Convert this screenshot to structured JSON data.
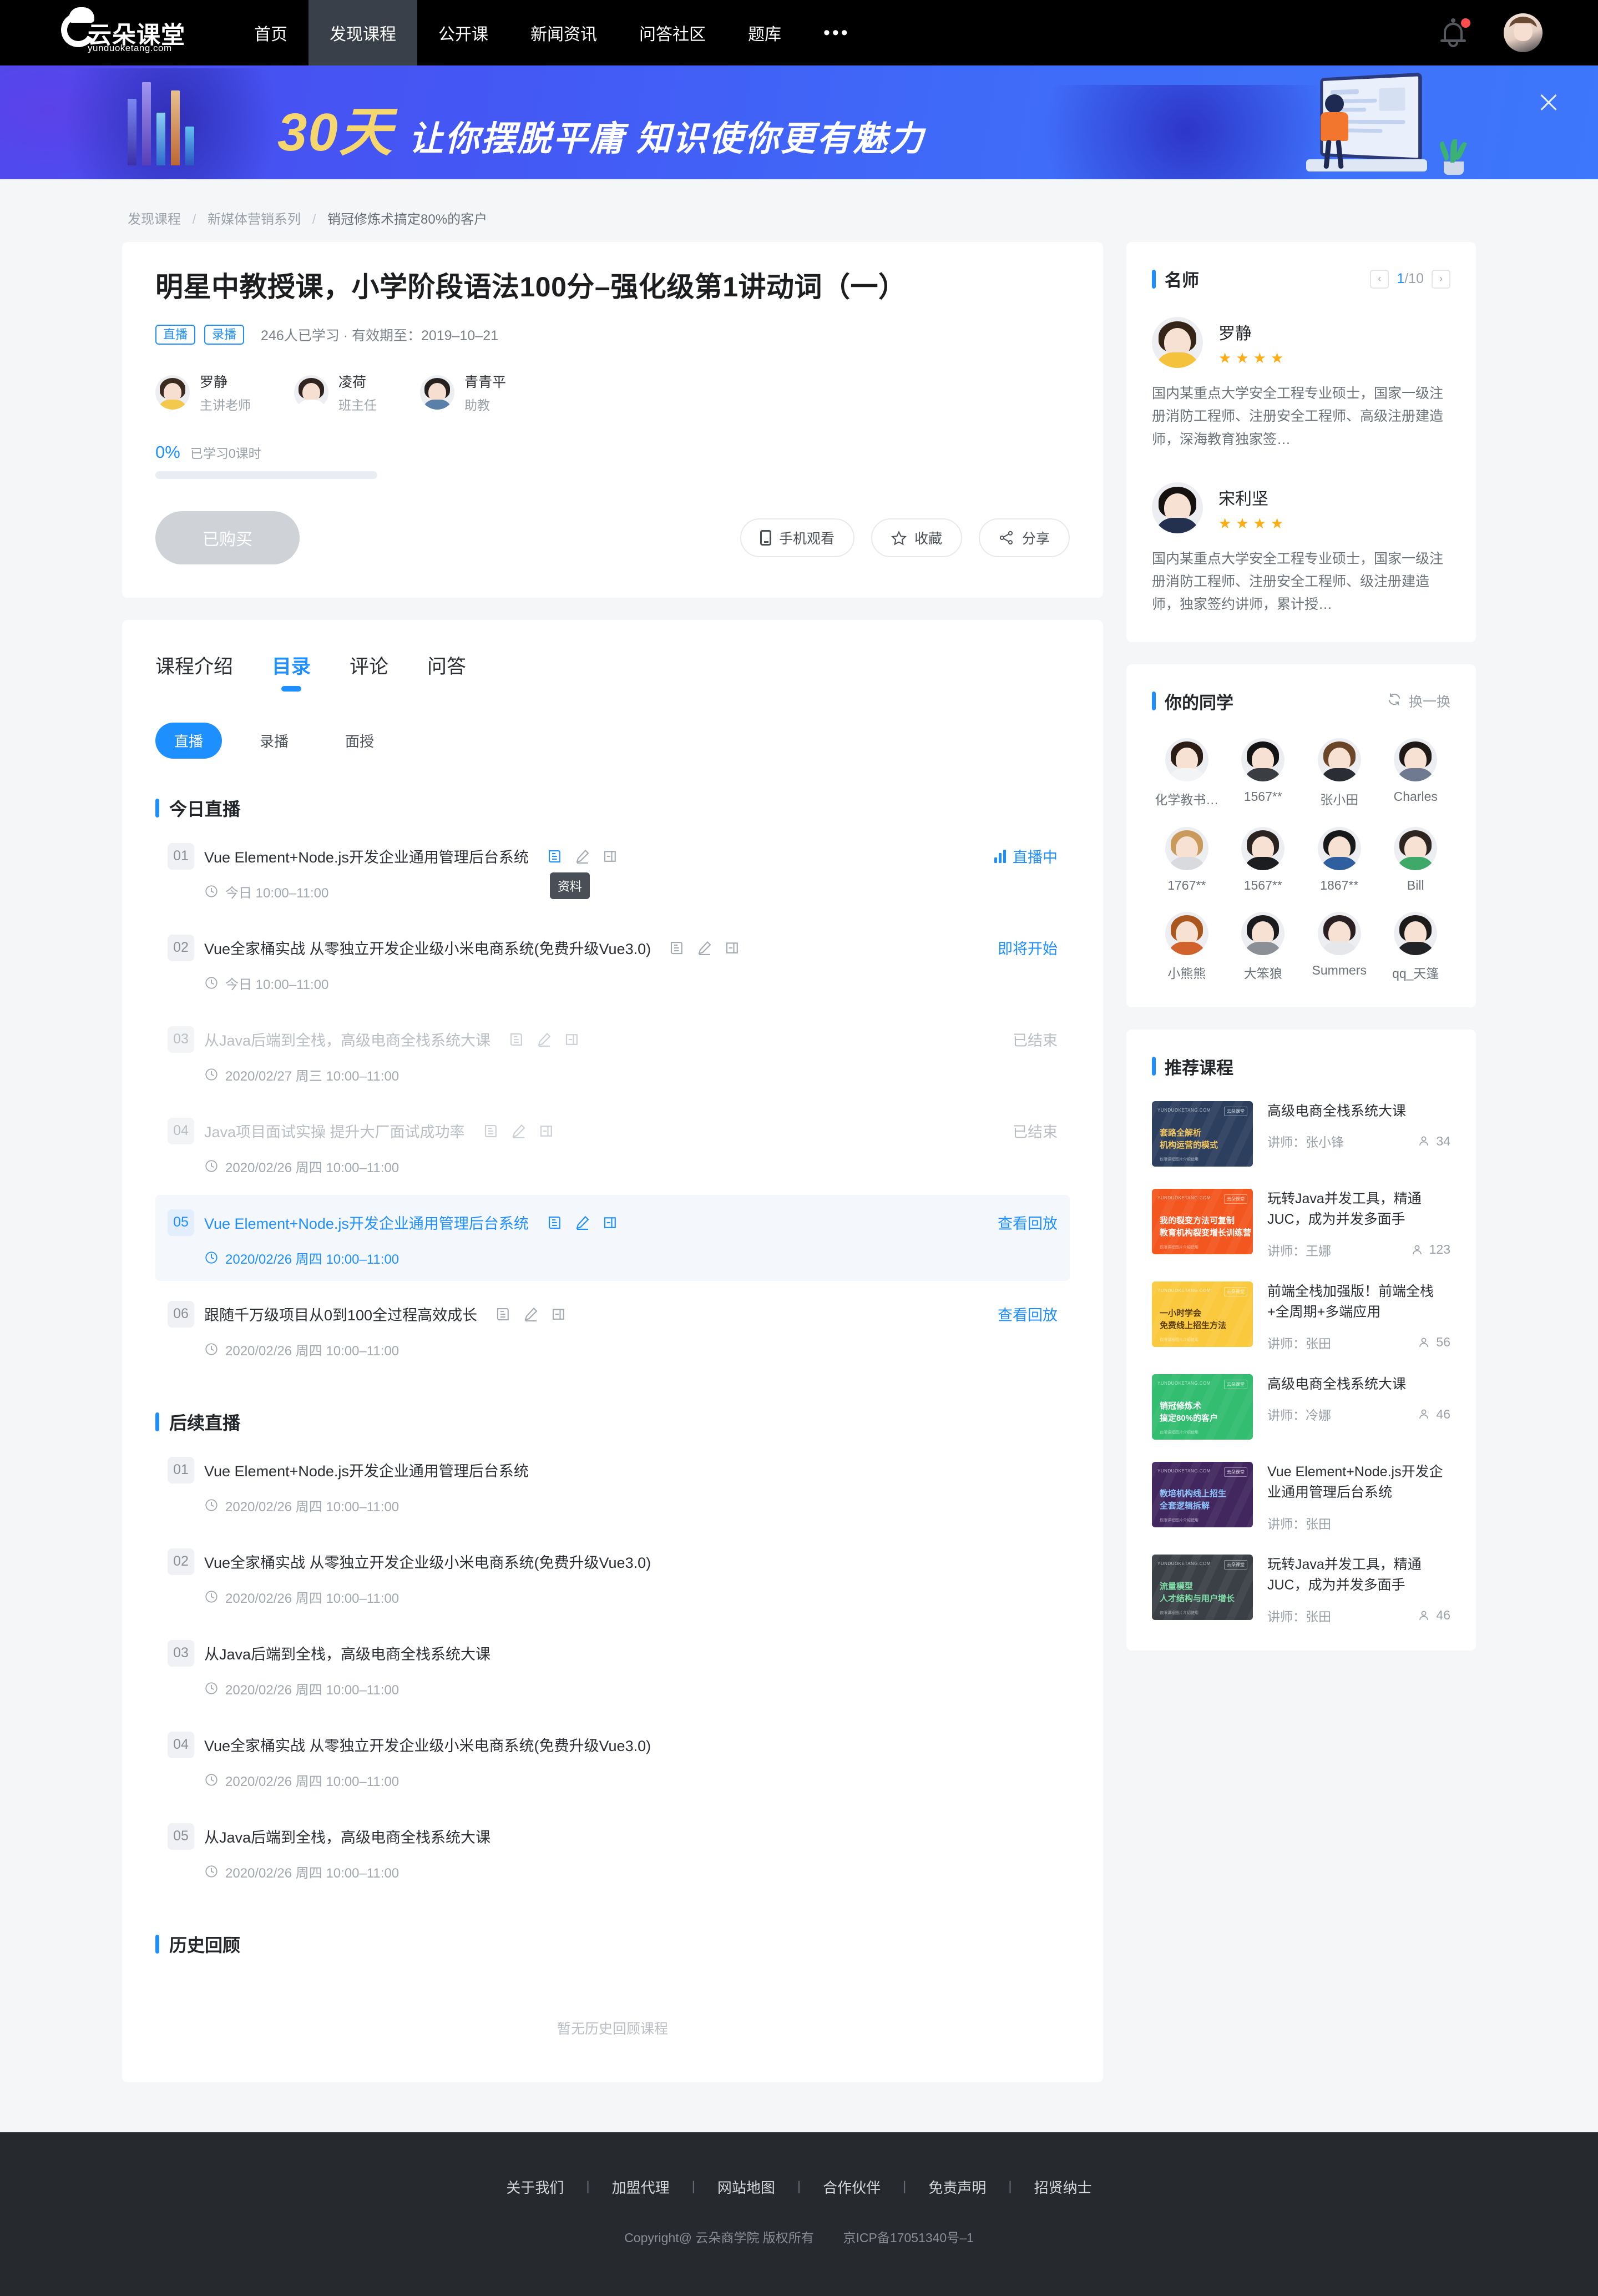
{
  "nav": {
    "logo_cn": "云朵课堂",
    "logo_en": "yunduoketang.com",
    "items": [
      {
        "label": "首页",
        "active": false
      },
      {
        "label": "发现课程",
        "active": true
      },
      {
        "label": "公开课",
        "active": false
      },
      {
        "label": "新闻资讯",
        "active": false
      },
      {
        "label": "问答社区",
        "active": false
      },
      {
        "label": "题库",
        "active": false
      },
      {
        "label": "•••",
        "active": false
      }
    ],
    "bell_icon": "bell-icon",
    "avatar_icon": "user-avatar"
  },
  "banner": {
    "highlight": "30天",
    "text": "让你摆脱平庸  知识使你更有魅力",
    "close_icon": "close-icon"
  },
  "breadcrumb": {
    "items": [
      "发现课程",
      "新媒体营销系列",
      "销冠修炼术搞定80%的客户"
    ],
    "separator": "/"
  },
  "hero": {
    "title": "明星中教授课，小学阶段语法100分–强化级第1讲动词（一）",
    "tags": [
      "直播",
      "录播"
    ],
    "subtitle": "246人已学习 · 有效期至：2019–10–21",
    "teachers": [
      {
        "name": "罗静",
        "role": "主讲老师"
      },
      {
        "name": "凌荷",
        "role": "班主任"
      },
      {
        "name": "青青平",
        "role": "助教"
      }
    ],
    "progress_pct": "0%",
    "progress_value": 0,
    "progress_label": "已学习0课时",
    "buy_button": "已购买",
    "actions": [
      {
        "label": "手机观看",
        "icon": "phone-icon"
      },
      {
        "label": "收藏",
        "icon": "star-icon"
      },
      {
        "label": "分享",
        "icon": "share-icon"
      }
    ]
  },
  "tabs": [
    {
      "label": "课程介绍",
      "active": false
    },
    {
      "label": "目录",
      "active": true
    },
    {
      "label": "评论",
      "active": false
    },
    {
      "label": "问答",
      "active": false
    }
  ],
  "chips": [
    {
      "label": "直播",
      "active": true
    },
    {
      "label": "录播",
      "active": false
    },
    {
      "label": "面授",
      "active": false
    }
  ],
  "sections": [
    {
      "title": "今日直播",
      "lessons": [
        {
          "num": "01",
          "title": "Vue Element+Node.js开发企业通用管理后台系统",
          "time": "今日 10:00–11:00",
          "status": "直播中",
          "state": "live",
          "icons": true,
          "tooltip": "资料"
        },
        {
          "num": "02",
          "title": "Vue全家桶实战 从零独立开发企业级小米电商系统(免费升级Vue3.0)",
          "time": "今日 10:00–11:00",
          "status": "即将开始",
          "state": "upcoming",
          "icons": true
        },
        {
          "num": "03",
          "title": "从Java后端到全栈，高级电商全栈系统大课",
          "time": "2020/02/27 周三 10:00–11:00",
          "status": "已结束",
          "state": "ended",
          "icons": true
        },
        {
          "num": "04",
          "title": "Java项目面试实操 提升大厂面试成功率",
          "time": "2020/02/26 周四 10:00–11:00",
          "status": "已结束",
          "state": "ended",
          "icons": true
        },
        {
          "num": "05",
          "title": "Vue Element+Node.js开发企业通用管理后台系统",
          "time": "2020/02/26 周四 10:00–11:00",
          "status": "查看回放",
          "state": "highlight",
          "icons": true
        },
        {
          "num": "06",
          "title": "跟随千万级项目从0到100全过程高效成长",
          "time": "2020/02/26 周四 10:00–11:00",
          "status": "查看回放",
          "state": "replay",
          "icons": true
        }
      ]
    },
    {
      "title": "后续直播",
      "lessons": [
        {
          "num": "01",
          "title": "Vue Element+Node.js开发企业通用管理后台系统",
          "time": "2020/02/26 周四 10:00–11:00",
          "status": "",
          "state": "plain",
          "icons": false
        },
        {
          "num": "02",
          "title": "Vue全家桶实战 从零独立开发企业级小米电商系统(免费升级Vue3.0)",
          "time": "2020/02/26 周四 10:00–11:00",
          "status": "",
          "state": "plain",
          "icons": false
        },
        {
          "num": "03",
          "title": "从Java后端到全栈，高级电商全栈系统大课",
          "time": "2020/02/26 周四 10:00–11:00",
          "status": "",
          "state": "plain",
          "icons": false
        },
        {
          "num": "04",
          "title": "Vue全家桶实战 从零独立开发企业级小米电商系统(免费升级Vue3.0)",
          "time": "2020/02/26 周四 10:00–11:00",
          "status": "",
          "state": "plain",
          "icons": false
        },
        {
          "num": "05",
          "title": "从Java后端到全栈，高级电商全栈系统大课",
          "time": "2020/02/26 周四 10:00–11:00",
          "status": "",
          "state": "plain",
          "icons": false
        }
      ]
    },
    {
      "title": "历史回顾",
      "lessons": [],
      "empty": "暂无历史回顾课程"
    }
  ],
  "side_teachers": {
    "title": "名师",
    "page_current": "1",
    "page_total": "/10",
    "prev_icon": "chevron-left-icon",
    "next_icon": "chevron-right-icon",
    "list": [
      {
        "name": "罗静",
        "stars": 4,
        "desc": "国内某重点大学安全工程专业硕士，国家一级注册消防工程师、注册安全工程师、高级注册建造师，深海教育独家签…"
      },
      {
        "name": "宋利坚",
        "stars": 4,
        "desc": "国内某重点大学安全工程专业硕士，国家一级注册消防工程师、注册安全工程师、级注册建造师，独家签约讲师，累计授…"
      }
    ]
  },
  "side_mates": {
    "title": "你的同学",
    "refresh_label": "换一换",
    "refresh_icon": "refresh-icon",
    "list": [
      {
        "name": "化学教书…"
      },
      {
        "name": "1567**"
      },
      {
        "name": "张小田"
      },
      {
        "name": "Charles"
      },
      {
        "name": "1767**"
      },
      {
        "name": "1567**"
      },
      {
        "name": "1867**"
      },
      {
        "name": "Bill"
      },
      {
        "name": "小熊熊"
      },
      {
        "name": "大笨狼"
      },
      {
        "name": "Summers"
      },
      {
        "name": "qq_天篷"
      }
    ]
  },
  "side_recommend": {
    "title": "推荐课程",
    "teacher_prefix": "讲师：",
    "list": [
      {
        "title": "高级电商全栈系统大课",
        "teacher": "张小锋",
        "count": "34",
        "thumb_color": "#2c3f5e",
        "thumb_l1": "套路全解析",
        "thumb_l2": "机构运营的模式",
        "thumb_title_color": "#f5c862"
      },
      {
        "title": "玩转Java并发工具，精通JUC，成为并发多面手",
        "teacher": "王娜",
        "count": "123",
        "thumb_color": "#f4561f",
        "thumb_l1": "我的裂变方法可复制",
        "thumb_l2": "教育机构裂变增长训练营",
        "thumb_title_color": "#ffffff"
      },
      {
        "title": "前端全栈加强版！前端全栈+全周期+多端应用",
        "teacher": "张田",
        "count": "56",
        "thumb_color": "#fbc93d",
        "thumb_l1": "一小时学会",
        "thumb_l2": "免费线上招生方法",
        "thumb_title_color": "#5a3c05"
      },
      {
        "title": "高级电商全栈系统大课",
        "teacher": "冷娜",
        "count": "46",
        "thumb_color": "#32bd70",
        "thumb_l1": "销冠修炼术",
        "thumb_l2": "搞定80%的客户",
        "thumb_title_color": "#ffffff"
      },
      {
        "title": "Vue Element+Node.js开发企业通用管理后台系统",
        "teacher": "张田",
        "count": "",
        "thumb_color": "#41275e",
        "thumb_l1": "教培机构线上招生",
        "thumb_l2": "全套逻辑拆解",
        "thumb_title_color": "#8fc6ff"
      },
      {
        "title": "玩转Java并发工具，精通JUC，成为并发多面手",
        "teacher": "张田",
        "count": "46",
        "thumb_color": "#3b4047",
        "thumb_l1": "流量模型",
        "thumb_l2": "人才结构与用户增长",
        "thumb_title_color": "#7fe0a8"
      }
    ]
  },
  "footer": {
    "links": [
      "关于我们",
      "加盟代理",
      "网站地图",
      "合作伙伴",
      "免责声明",
      "招贤纳士"
    ],
    "separator": "|",
    "copyright": "Copyright@ 云朵商学院  版权所有",
    "icp": "京ICP备17051340号–1"
  },
  "colors": {
    "primary": "#1e8fff",
    "nav_bg": "#000000",
    "banner_start": "#4a4df0",
    "star": "#fbad16",
    "page_bg": "#f5f6f8"
  }
}
